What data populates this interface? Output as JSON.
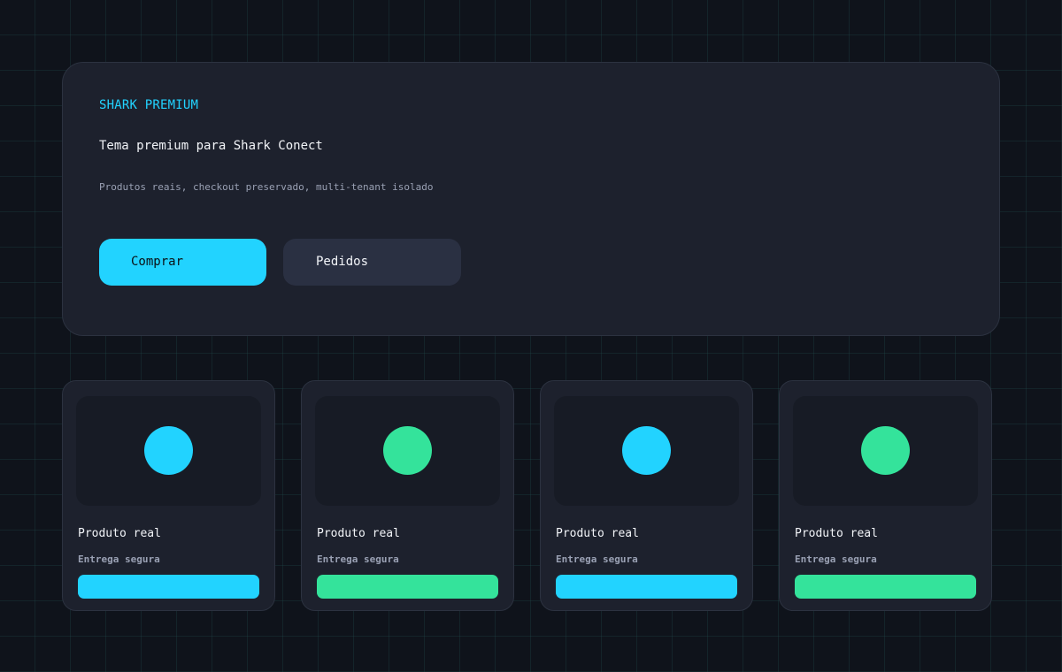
{
  "hero": {
    "kicker": "SHARK PREMIUM",
    "title": "Tema premium para Shark Conect",
    "subtitle": "Produtos reais, checkout preservado, multi-tenant isolado",
    "primary_button": "Comprar",
    "secondary_button": "Pedidos"
  },
  "products": [
    {
      "title": "Produto real",
      "subtitle": "Entrega segura",
      "accent": "#22d3ff"
    },
    {
      "title": "Produto real",
      "subtitle": "Entrega segura",
      "accent": "#34e39b"
    },
    {
      "title": "Produto real",
      "subtitle": "Entrega segura",
      "accent": "#22d3ff"
    },
    {
      "title": "Produto real",
      "subtitle": "Entrega segura",
      "accent": "#34e39b"
    }
  ],
  "colors": {
    "background": "#0f131b",
    "panel": "#1d212d",
    "accent_cyan": "#22d3ff",
    "accent_green": "#34e39b",
    "muted_text": "#9aa1b4"
  }
}
